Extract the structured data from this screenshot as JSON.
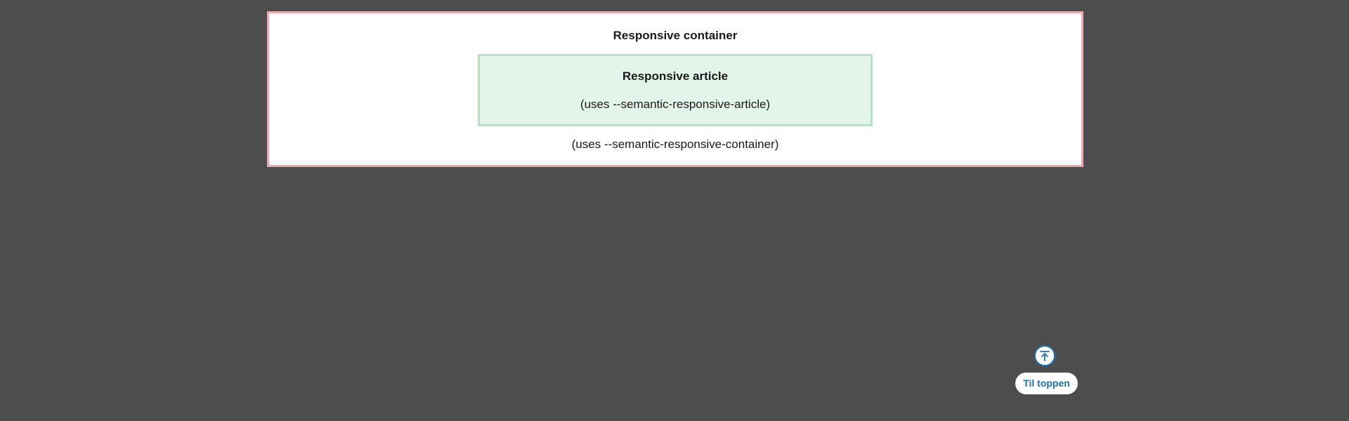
{
  "container": {
    "title": "Responsive container",
    "note": "(uses --semantic-responsive-container)",
    "border_color": "#f2a6b0",
    "background": "#ffffff"
  },
  "article": {
    "title": "Responsive article",
    "note": "(uses --semantic-responsive-article)",
    "border_color": "#b7e0c7",
    "background": "#e3f4ea"
  },
  "to_top": {
    "label": "Til toppen",
    "icon": "arrow-up-to-top-icon",
    "color": "#1f6fb2"
  },
  "page": {
    "background": "#4d4d4d"
  }
}
